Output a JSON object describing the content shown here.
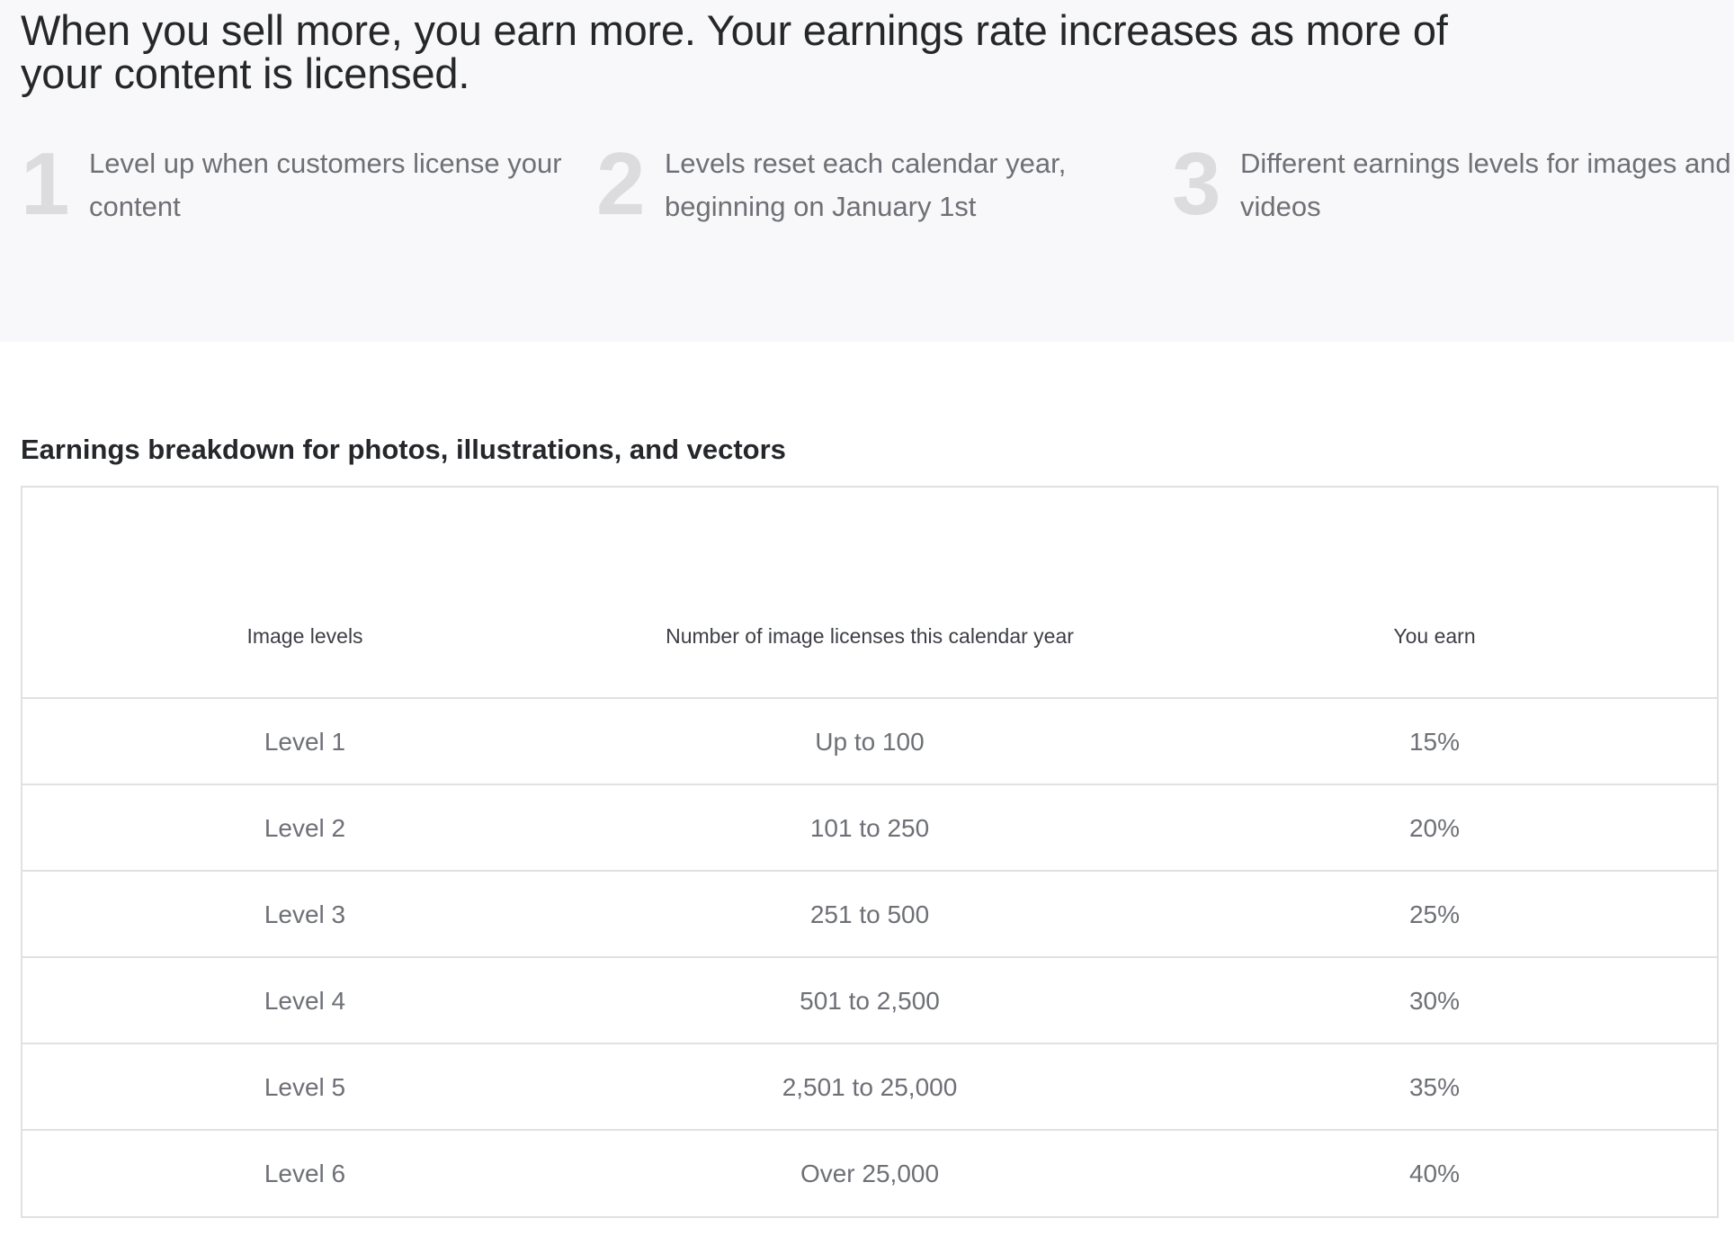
{
  "hero": {
    "headline": "When you sell more, you earn more. Your earnings rate increases as more of your content is licensed.",
    "steps": [
      {
        "number": "1",
        "text": "Level up when customers license your content"
      },
      {
        "number": "2",
        "text": "Levels reset each calendar year, beginning on January 1st"
      },
      {
        "number": "3",
        "text": "Different earnings levels for images and videos"
      }
    ]
  },
  "earnings": {
    "title": "Earnings breakdown for photos, illustrations, and vectors",
    "headers": [
      "Image levels",
      "Number of image licenses this calendar year",
      "You earn"
    ],
    "rows": [
      [
        "Level 1",
        "Up to 100",
        "15%"
      ],
      [
        "Level 2",
        "101 to 250",
        "20%"
      ],
      [
        "Level 3",
        "251 to 500",
        "25%"
      ],
      [
        "Level 4",
        "501 to 2,500",
        "30%"
      ],
      [
        "Level 5",
        "2,501 to 25,000",
        "35%"
      ],
      [
        "Level 6",
        "Over 25,000",
        "40%"
      ]
    ]
  }
}
